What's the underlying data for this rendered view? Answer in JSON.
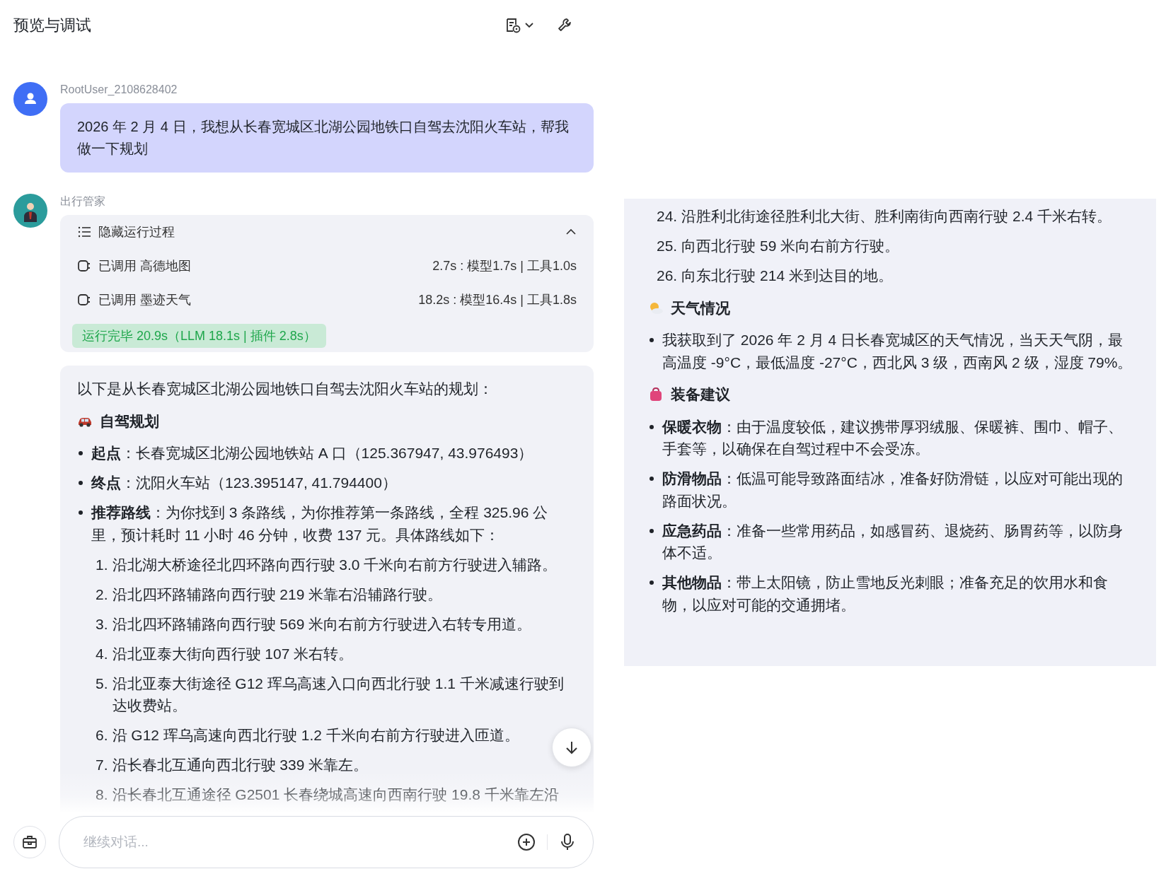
{
  "header": {
    "title": "预览与调试"
  },
  "messages": [
    {
      "kind": "user",
      "author": "RootUser_2108628402",
      "text": "2026 年 2 月 4 日，我想从长春宽城区北湖公园地铁口自驾去沈阳火车站，帮我做一下规划"
    },
    {
      "kind": "bot",
      "author": "出行管家",
      "process": {
        "toggle_label": "隐藏运行过程",
        "expanded": true,
        "steps": [
          {
            "label": "已调用 高德地图",
            "timing": "2.7s : 模型1.7s | 工具1.0s"
          },
          {
            "label": "已调用 墨迹天气",
            "timing": "18.2s : 模型16.4s | 工具1.8s"
          }
        ],
        "summary": "运行完毕 20.9s（LLM 18.1s | 插件 2.8s）"
      },
      "reply": [
        {
          "kind": "paragraph",
          "text": "以下是从长春宽城区北湖公园地铁口自驾去沈阳火车站的规划："
        },
        {
          "kind": "heading",
          "text": "自驾规划"
        },
        {
          "kind": "bullet",
          "text": "**起点**：长春宽城区北湖公园地铁站 A 口（125.367947, 43.976493）"
        },
        {
          "kind": "bullet",
          "text": "**终点**：沈阳火车站（123.395147, 41.794400）"
        },
        {
          "kind": "bullet",
          "text": "**推荐路线**：为你找到 3 条路线，为你推荐第一条路线，全程 325.96 公里，预计耗时 11 小时 46 分钟，收费 137 元。具体路线如下："
        },
        {
          "kind": "step",
          "number": "1.",
          "text": "沿北湖大桥途径北四环路向西行驶 3.0 千米向右前方行驶进入辅路。"
        },
        {
          "kind": "step",
          "number": "2.",
          "text": "沿北四环路辅路向西行驶 219 米靠右沿辅路行驶。"
        },
        {
          "kind": "step",
          "number": "3.",
          "text": "沿北四环路辅路向西行驶 569 米向右前方行驶进入右转专用道。"
        },
        {
          "kind": "step",
          "number": "4.",
          "text": "沿北亚泰大街向西行驶 107 米右转。"
        },
        {
          "kind": "step",
          "number": "5.",
          "text": "沿北亚泰大街途径 G12 珲乌高速入口向西北行驶 1.1 千米减速行驶到达收费站。"
        },
        {
          "kind": "step",
          "number": "6.",
          "text": "沿 G12 珲乌高速向西北行驶 1.2 千米向右前方行驶进入匝道。"
        },
        {
          "kind": "step",
          "number": "7.",
          "text": "沿长春北互通向西北行驶 339 米靠左。"
        },
        {
          "kind": "step",
          "number": "8.",
          "text": "沿长春北互通途径 G2501 长春绕城高速向西南行驶 19.8 千米靠左沿"
        }
      ]
    }
  ],
  "continuation": [
    {
      "kind": "step",
      "number": "24.",
      "text": "沿胜利北街途径胜利北大街、胜利南街向西南行驶 2.4 千米右转。"
    },
    {
      "kind": "step",
      "number": "25.",
      "text": "向西北行驶 59 米向右前方行驶。"
    },
    {
      "kind": "step",
      "number": "26.",
      "text": "向东北行驶 214 米到达目的地。"
    },
    {
      "kind": "heading",
      "text": "天气情况"
    },
    {
      "kind": "bullet",
      "text": "我获取到了 2026 年 2 月 4 日长春宽城区的天气情况，当天天气阴，最高温度 -9°C，最低温度 -27°C，西北风 3 级，西南风 2 级，湿度 79%。"
    },
    {
      "kind": "heading",
      "text": "装备建议"
    },
    {
      "kind": "bullet",
      "text": "**保暖衣物**：由于温度较低，建议携带厚羽绒服、保暖裤、围巾、帽子、手套等，以确保在自驾过程中不会受冻。"
    },
    {
      "kind": "bullet",
      "text": "**防滑物品**：低温可能导致路面结冰，准备好防滑链，以应对可能出现的路面状况。"
    },
    {
      "kind": "bullet",
      "text": "**应急药品**：准备一些常用药品，如感冒药、退烧药、肠胃药等，以防身体不适。"
    },
    {
      "kind": "bullet",
      "text": "**其他物品**：带上太阳镜，防止雪地反光刺眼；准备充足的饮用水和食物，以应对可能的交通拥堵。"
    }
  ],
  "composer": {
    "placeholder": "继续对话..."
  }
}
